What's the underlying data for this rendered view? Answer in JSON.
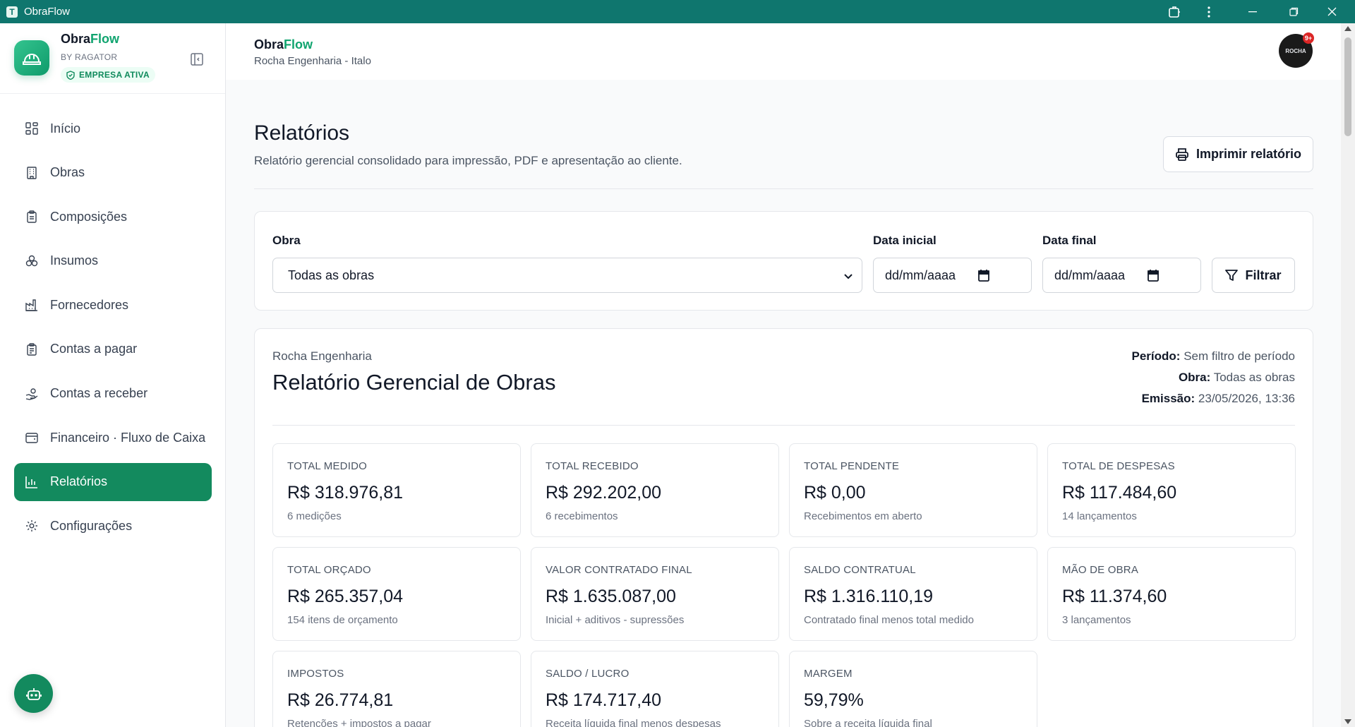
{
  "window": {
    "title": "ObraFlow"
  },
  "brand": {
    "name_prefix": "Obra",
    "name_accent": "Flow",
    "by": "BY RAGATOR",
    "badge": "EMPRESA ATIVA"
  },
  "nav": [
    {
      "label": "Início",
      "icon": "dashboard-grid-icon",
      "active": false
    },
    {
      "label": "Obras",
      "icon": "building-icon",
      "active": false
    },
    {
      "label": "Composições",
      "icon": "clipboard-icon",
      "active": false
    },
    {
      "label": "Insumos",
      "icon": "boxes-icon",
      "active": false
    },
    {
      "label": "Fornecedores",
      "icon": "factory-icon",
      "active": false
    },
    {
      "label": "Contas a pagar",
      "icon": "receipt-icon",
      "active": false
    },
    {
      "label": "Contas a receber",
      "icon": "hand-coins-icon",
      "active": false
    },
    {
      "label": "Financeiro · Fluxo de Caixa",
      "icon": "wallet-icon",
      "active": false
    },
    {
      "label": "Relatórios",
      "icon": "bar-chart-icon",
      "active": true
    },
    {
      "label": "Configurações",
      "icon": "gear-icon",
      "active": false
    }
  ],
  "header": {
    "title_prefix": "Obra",
    "title_accent": "Flow",
    "subtitle": "Rocha Engenharia - Italo",
    "avatar_text": "ROCHA",
    "notification_count": "9+"
  },
  "page": {
    "title": "Relatórios",
    "subtitle": "Relatório gerencial consolidado para impressão, PDF e apresentação ao cliente.",
    "print_label": "Imprimir relatório"
  },
  "filters": {
    "obra_label": "Obra",
    "obra_value": "Todas as obras",
    "start_label": "Data inicial",
    "start_placeholder": "dd/mm/aaaa",
    "end_label": "Data final",
    "end_placeholder": "dd/mm/aaaa",
    "filter_label": "Filtrar"
  },
  "report": {
    "company": "Rocha Engenharia",
    "title": "Relatório Gerencial de Obras",
    "period_label": "Período:",
    "period_value": "Sem filtro de período",
    "obra_label": "Obra:",
    "obra_value": "Todas as obras",
    "emission_label": "Emissão:",
    "emission_value": "23/05/2026, 13:36"
  },
  "kpis": [
    {
      "label": "TOTAL MEDIDO",
      "value": "R$ 318.976,81",
      "note": "6 medições"
    },
    {
      "label": "TOTAL RECEBIDO",
      "value": "R$ 292.202,00",
      "note": "6 recebimentos"
    },
    {
      "label": "TOTAL PENDENTE",
      "value": "R$ 0,00",
      "note": "Recebimentos em aberto"
    },
    {
      "label": "TOTAL DE DESPESAS",
      "value": "R$ 117.484,60",
      "note": "14 lançamentos"
    },
    {
      "label": "TOTAL ORÇADO",
      "value": "R$ 265.357,04",
      "note": "154 itens de orçamento"
    },
    {
      "label": "VALOR CONTRATADO FINAL",
      "value": "R$ 1.635.087,00",
      "note": "Inicial + aditivos - supressões"
    },
    {
      "label": "SALDO CONTRATUAL",
      "value": "R$ 1.316.110,19",
      "note": "Contratado final menos total medido"
    },
    {
      "label": "MÃO DE OBRA",
      "value": "R$ 11.374,60",
      "note": "3 lançamentos"
    },
    {
      "label": "IMPOSTOS",
      "value": "R$ 26.774,81",
      "note": "Retenções + impostos a pagar"
    },
    {
      "label": "SALDO / LUCRO",
      "value": "R$ 174.717,40",
      "note": "Receita líquida final menos despesas"
    },
    {
      "label": "MARGEM",
      "value": "59,79%",
      "note": "Sobre a receita líquida final"
    }
  ],
  "colors": {
    "primary": "#138a5e",
    "accent": "#10a46f",
    "titlebar": "#0f766e"
  }
}
